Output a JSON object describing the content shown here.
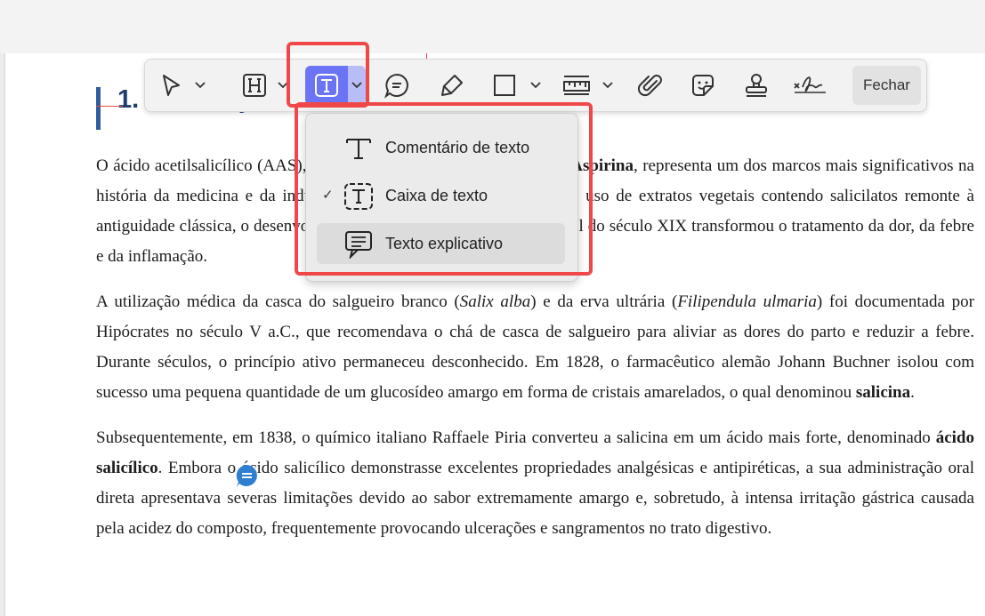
{
  "document": {
    "heading": "1. Introdução",
    "paragraphs": [
      [
        {
          "t": "O ácido acetilsalicílico (AAS), mais conhecido pelo nome comercial "
        },
        {
          "t": "Aspirina",
          "b": true
        },
        {
          "t": ", representa um dos marcos mais significativos na história da medicina e da indústria farmacêutica sintética. Embora o uso de extratos vegetais contendo salicilatos remonte à antiguidade clássica, o desenvolvimento do AAS puro e estável no final do século XIX transformou o tratamento da dor, da febre e da inflamação."
        }
      ],
      [
        {
          "t": "A utilização médica da casca do salgueiro branco ("
        },
        {
          "t": "Salix alba",
          "i": true
        },
        {
          "t": ") e da erva ultrária ("
        },
        {
          "t": "Filipendula ulmaria",
          "i": true
        },
        {
          "t": ") foi documentada por Hipócrates no século V a.C., que recomendava o chá de casca de salgueiro para aliviar as dores do parto e reduzir a febre. Durante séculos, o princípio ativo permaneceu desconhecido. Em 1828, o farmacêutico alemão Johann Buchner isolou com sucesso uma pequena quantidade de um glucosídeo amargo em forma de cristais amarelados, o qual denominou "
        },
        {
          "t": "salicina",
          "b": true
        },
        {
          "t": "."
        }
      ],
      [
        {
          "t": "Subsequentemente, em 1838, o químico italiano Raffaele Piria converteu a salicina em um ácido mais forte, denominado "
        },
        {
          "t": "ácido salicílico",
          "b": true
        },
        {
          "t": ". Embora o ácido salicílico demonstrasse excelentes propriedades analgésicas e antipiréticas, a sua administração oral direta apresentava severas limitações devido ao sabor extremamente amargo e, sobretudo, à intensa irritação gástrica causada pela acidez do composto, frequentemente provocando ulcerações e sangramentos no trato digestivo."
        }
      ]
    ]
  },
  "toolbar": {
    "tools": [
      "select-tool",
      "heading-tool",
      "text-tool",
      "comment-tool",
      "highlighter-tool",
      "shape-tool",
      "measure-tool",
      "attachment-tool",
      "sticker-tool",
      "stamp-tool",
      "signature-tool"
    ],
    "active_tool": "text-tool",
    "close_label": "Fechar"
  },
  "text_menu": {
    "items": [
      {
        "label": "Comentário de texto",
        "icon": "text-comment-icon",
        "checked": false,
        "hovered": false
      },
      {
        "label": "Caixa de texto",
        "icon": "text-box-icon",
        "checked": true,
        "hovered": false
      },
      {
        "label": "Texto explicativo",
        "icon": "callout-icon",
        "checked": false,
        "hovered": true
      }
    ],
    "check_mark": "✓"
  },
  "colors": {
    "accent": "#6b74f5",
    "highlight_box": "#f04848",
    "heading": "#1f3d6e",
    "comment_marker": "#2f7fd1"
  }
}
